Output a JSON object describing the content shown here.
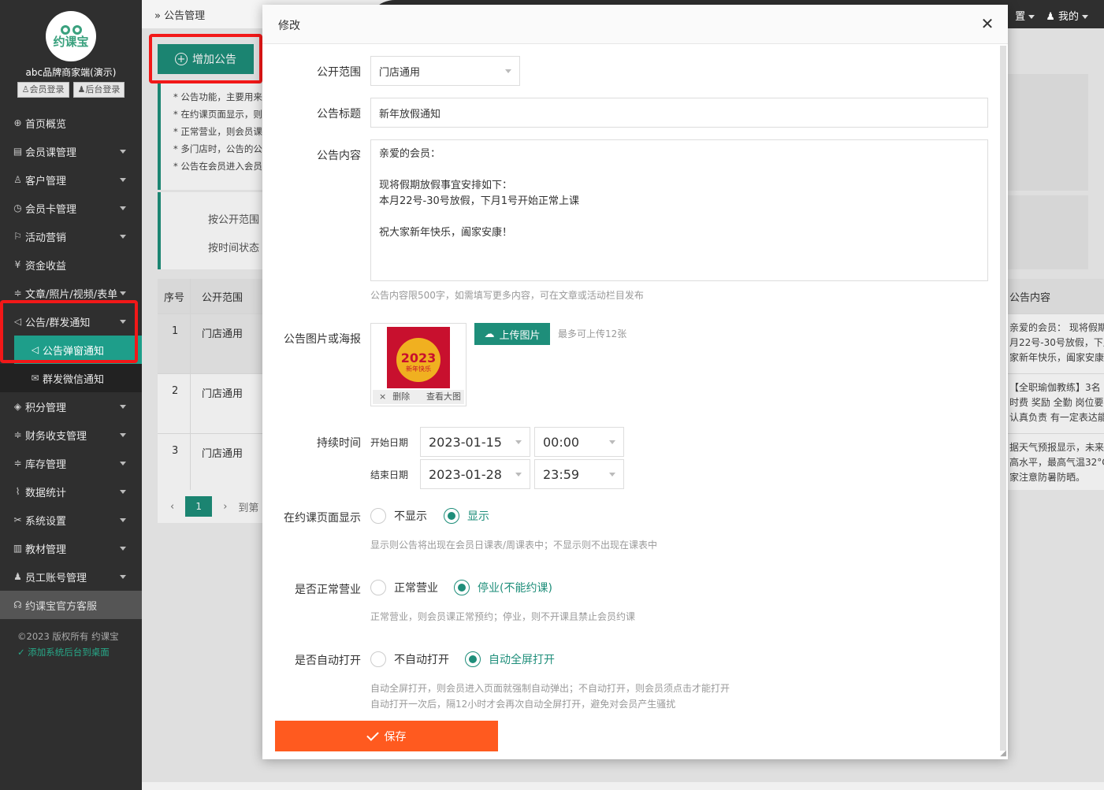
{
  "sidebar": {
    "logo_text": "约课宝",
    "shop_name": "abc品牌商家端(演示)",
    "member_login": "会员登录",
    "admin_login": "后台登录",
    "items": [
      {
        "label": "首页概览",
        "icon": "globe-icon"
      },
      {
        "label": "会员课管理",
        "icon": "document-icon"
      },
      {
        "label": "客户管理",
        "icon": "user-icon"
      },
      {
        "label": "会员卡管理",
        "icon": "clock-icon"
      },
      {
        "label": "活动营销",
        "icon": "flag-icon"
      },
      {
        "label": "资金收益",
        "icon": "yen-icon"
      },
      {
        "label": "文章/照片/视频/表单",
        "icon": "sliders-icon"
      },
      {
        "label": "公告/群发通知",
        "icon": "speaker-icon"
      },
      {
        "label": "积分管理",
        "icon": "diamond-icon"
      },
      {
        "label": "财务收支管理",
        "icon": "sliders-icon"
      },
      {
        "label": "库存管理",
        "icon": "sliders-icon"
      },
      {
        "label": "数据统计",
        "icon": "pulse-icon"
      },
      {
        "label": "系统设置",
        "icon": "tools-icon"
      },
      {
        "label": "教材管理",
        "icon": "book-icon"
      },
      {
        "label": "员工账号管理",
        "icon": "person-icon"
      }
    ],
    "sub_items": [
      {
        "label": "公告弹窗通知",
        "icon": "speaker-icon"
      },
      {
        "label": "群发微信通知",
        "icon": "mail-icon"
      }
    ],
    "service": "约课宝官方客服",
    "copyright": "©2023 版权所有 约课宝",
    "add_desktop": "添加系统后台到桌面"
  },
  "topbar": {
    "breadcrumb": "公告管理",
    "settings_partial": "置",
    "mine": "我的"
  },
  "background": {
    "add_button": "增加公告",
    "tips": [
      "* 公告功能，主要用来",
      "* 在约课页面显示，则",
      "* 正常营业，则会员课",
      "* 多门店时，公告的公",
      "* 公告在会员进入会员"
    ],
    "filter_scope": "按公开范围",
    "filter_time": "按时间状态",
    "col_seq": "序号",
    "col_scope": "公开范围",
    "col_content": "公告内容",
    "rows": [
      {
        "seq": "1",
        "scope": "门店通用",
        "content": [
          "亲爱的会员： 现将假期",
          "月22号-30号放假，下月",
          "家新年快乐，阖家安康"
        ]
      },
      {
        "seq": "2",
        "scope": "门店通用",
        "content": [
          "【全职瑜伽教练】3名",
          "时费 奖励 全勤 岗位要",
          "认真负责 有一定表达能"
        ]
      },
      {
        "seq": "3",
        "scope": "门店通用",
        "content": [
          "据天气预报显示，未来",
          "高水平，最高气温32°C",
          "家注意防暑防晒。"
        ]
      }
    ],
    "page": "1",
    "goto_partial": "到第"
  },
  "modal": {
    "title": "修改",
    "scope_label": "公开范围",
    "scope_value": "门店通用",
    "title_label": "公告标题",
    "title_value": "新年放假通知",
    "content_label": "公告内容",
    "content_value": "亲爱的会员：\n\n现将假期放假事宜安排如下：\n本月22号-30号放假，下月1号开始正常上课\n\n祝大家新年快乐，阖家安康！",
    "content_hint": "公告内容限500字，如需填写更多内容，可在文章或活动栏目发布",
    "image_label": "公告图片或海报",
    "poster_year": "2023",
    "poster_sub": "新年快乐",
    "delete_label": "删除",
    "view_label": "查看大图",
    "upload_button": "上传图片",
    "upload_hint": "最多可上传12张",
    "duration_label": "持续时间",
    "start_label": "开始日期",
    "start_date": "2023-01-15",
    "start_time": "00:00",
    "end_label": "结束日期",
    "end_date": "2023-01-28",
    "end_time": "23:59",
    "show_label": "在约课页面显示",
    "show_no": "不显示",
    "show_yes": "显示",
    "show_hint": "显示则公告将出现在会员日课表/周课表中；不显示则不出现在课表中",
    "business_label": "是否正常营业",
    "business_normal": "正常营业",
    "business_stop": "停业(不能约课)",
    "business_hint": "正常营业，则会员课正常预约；停业，则不开课且禁止会员约课",
    "auto_label": "是否自动打开",
    "auto_no": "不自动打开",
    "auto_yes": "自动全屏打开",
    "auto_hint1": "自动全屏打开，则会员进入页面就强制自动弹出；不自动打开，则会员须点击才能打开",
    "auto_hint2": "自动打开一次后，隔12小时才会再次自动全屏打开，避免对会员产生骚扰",
    "save_button": "保存"
  }
}
